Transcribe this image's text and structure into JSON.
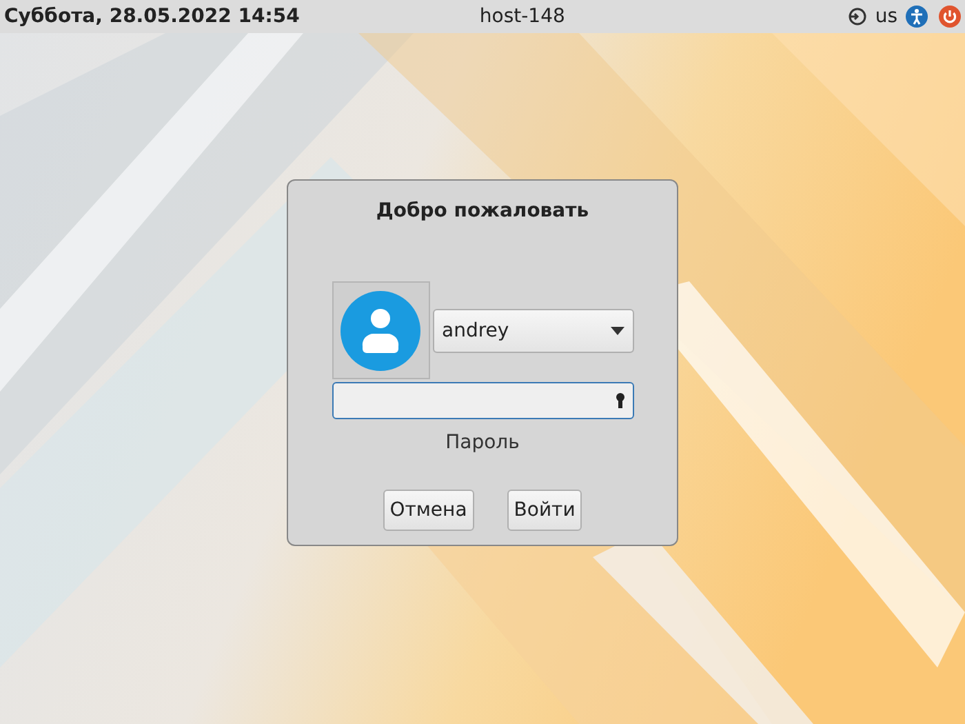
{
  "top_bar": {
    "datetime": "Суббота, 28.05.2022 14:54",
    "hostname": "host-148",
    "keyboard_layout": "us"
  },
  "login_dialog": {
    "title": "Добро пожаловать",
    "user": "andrey",
    "password_label": "Пароль",
    "buttons": [
      {
        "label": "Отмена"
      },
      {
        "label": "Войти"
      }
    ]
  }
}
